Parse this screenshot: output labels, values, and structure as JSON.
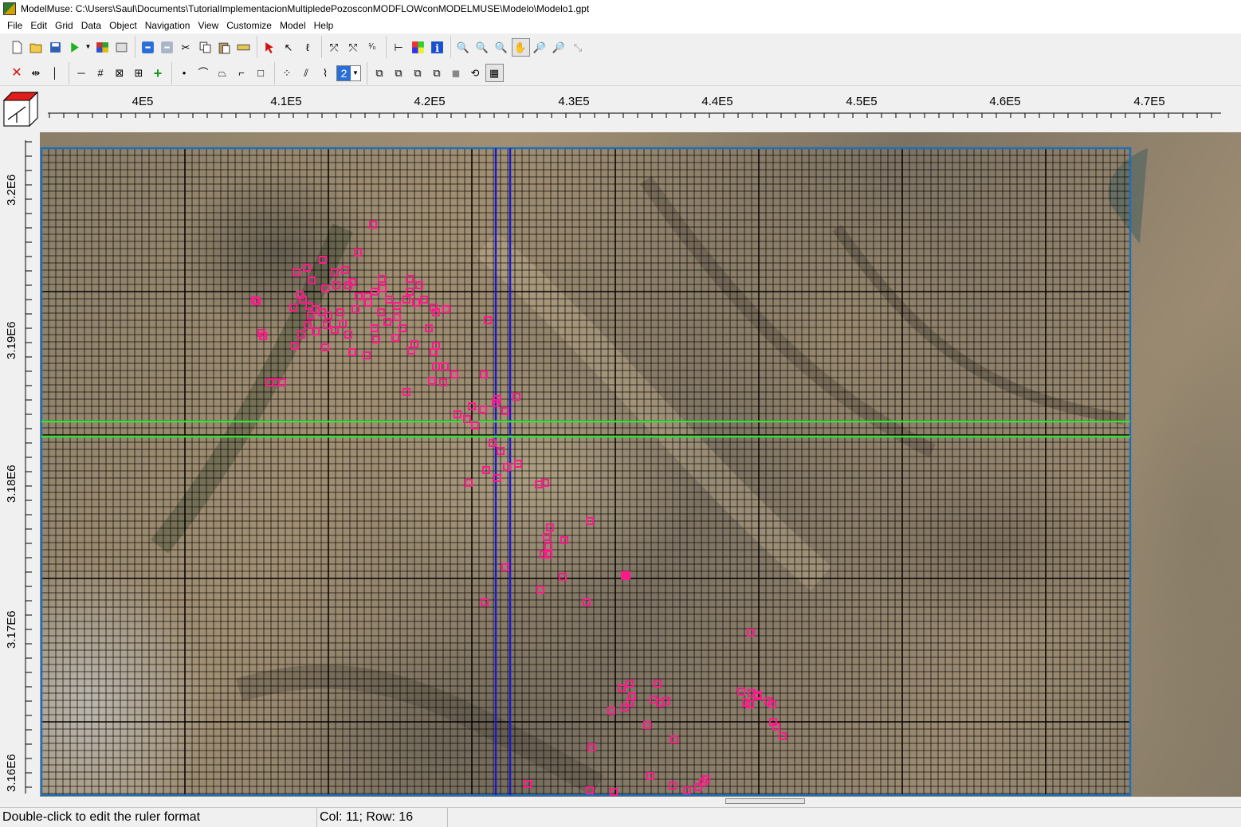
{
  "window": {
    "title": "ModelMuse: C:\\Users\\Saul\\Documents\\TutorialImplementacionMultipledePozosconMODFLOWconMODELMUSE\\Modelo\\Modelo1.gpt"
  },
  "menu": [
    "File",
    "Edit",
    "Grid",
    "Data",
    "Object",
    "Navigation",
    "View",
    "Customize",
    "Model",
    "Help"
  ],
  "toolbar": {
    "layer_select_value": "2"
  },
  "rulers": {
    "horizontal_labels": [
      "4E5",
      "4.1E5",
      "4.2E5",
      "4.3E5",
      "4.4E5",
      "4.5E5",
      "4.6E5",
      "4.7E5"
    ],
    "vertical_labels": [
      "3.2E6",
      "3.19E6",
      "3.18E6",
      "3.17E6",
      "3.16E6"
    ]
  },
  "grid": {
    "selected_column": 11,
    "selected_row": 16,
    "column_highlight_color": "#1a1acc",
    "row_highlight_color": "#39e03a",
    "well_color": "#ff1a8c"
  },
  "status": {
    "hint": "Double-click to edit the ruler format",
    "position": "Col: 11; Row: 16"
  }
}
